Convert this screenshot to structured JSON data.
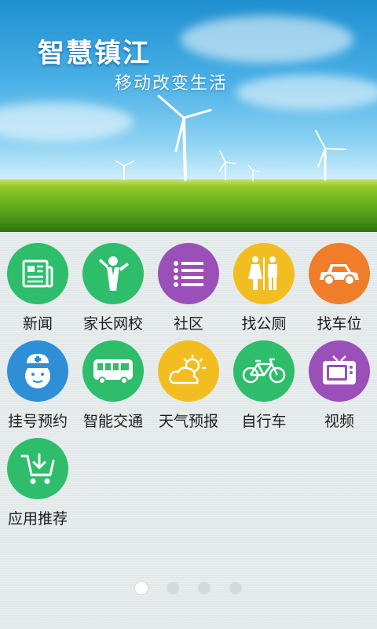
{
  "banner": {
    "title": "智慧镇江",
    "subtitle": "移动改变生活"
  },
  "apps": [
    {
      "label": "新闻",
      "icon": "newspaper-icon",
      "color": "#2ebd6b"
    },
    {
      "label": "家长网校",
      "icon": "teacher-icon",
      "color": "#2ebd6b"
    },
    {
      "label": "社区",
      "icon": "list-icon",
      "color": "#9b4fb8"
    },
    {
      "label": "找公厕",
      "icon": "restroom-icon",
      "color": "#f2bd20"
    },
    {
      "label": "找车位",
      "icon": "car-icon",
      "color": "#f07d2a"
    },
    {
      "label": "挂号预约",
      "icon": "nurse-icon",
      "color": "#2e8fd6"
    },
    {
      "label": "智能交通",
      "icon": "bus-icon",
      "color": "#2ebd6b"
    },
    {
      "label": "天气预报",
      "icon": "weather-icon",
      "color": "#f2bd20"
    },
    {
      "label": "自行车",
      "icon": "bicycle-icon",
      "color": "#2ebd6b"
    },
    {
      "label": "视频",
      "icon": "tv-icon",
      "color": "#9b4fb8"
    },
    {
      "label": "应用推荐",
      "icon": "download-cart-icon",
      "color": "#2ebd6b"
    }
  ],
  "pager": {
    "count": 4,
    "active_index": 0
  }
}
